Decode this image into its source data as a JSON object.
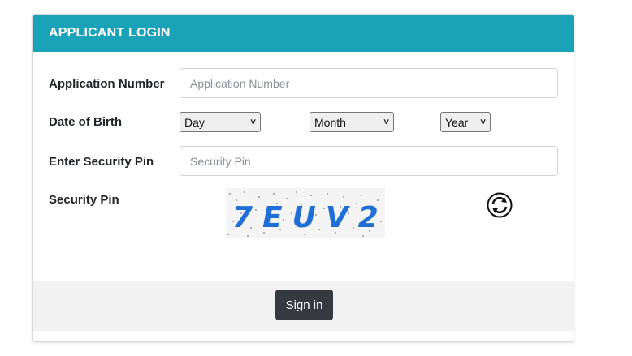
{
  "header": {
    "title": "APPLICANT LOGIN"
  },
  "form": {
    "application_number": {
      "label": "Application Number",
      "placeholder": "Application Number",
      "value": ""
    },
    "date_of_birth": {
      "label": "Date of Birth",
      "day": "Day",
      "month": "Month",
      "year": "Year"
    },
    "security_pin_input": {
      "label": "Enter Security Pin",
      "placeholder": "Security Pin",
      "value": ""
    },
    "security_pin": {
      "label": "Security Pin",
      "captcha_text": "7EUV2"
    }
  },
  "footer": {
    "signin_label": "Sign in"
  },
  "colors": {
    "header_bg": "#1aa3b8",
    "button_bg": "#343a40",
    "captcha_text": "#1f6fd6"
  },
  "icons": {
    "refresh": "refresh-icon"
  }
}
